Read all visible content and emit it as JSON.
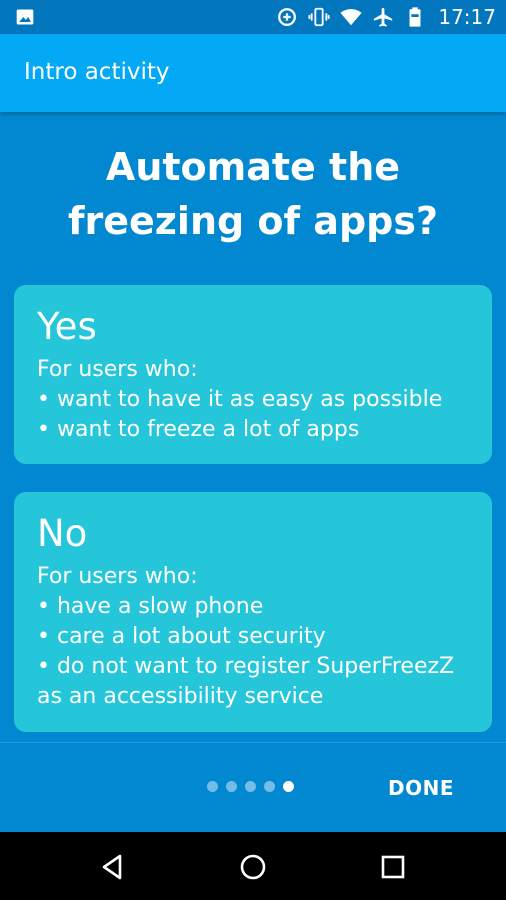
{
  "status_bar": {
    "time": "17:17",
    "icons": [
      "image-icon",
      "data-saver-icon",
      "vibrate-icon",
      "wifi-icon",
      "airplane-icon",
      "battery-icon"
    ]
  },
  "app_bar": {
    "title": "Intro activity"
  },
  "headline": "Automate the\nfreezing of apps?",
  "options": {
    "yes": {
      "title": "Yes",
      "lines": [
        "For users who:",
        "• want to have it as easy as possible",
        "• want to freeze a lot of apps"
      ]
    },
    "no": {
      "title": "No",
      "lines": [
        "For users who:",
        "• have a slow phone",
        "• care a lot about security",
        "• do not want to register SuperFreezZ",
        "as an accessibility service"
      ]
    }
  },
  "pager": {
    "total": 5,
    "current": 5
  },
  "footer": {
    "done_label": "DONE"
  },
  "colors": {
    "status_bar": "#0277bd",
    "app_bar": "#03a9f4",
    "background": "#0288d1",
    "card": "#26c6da"
  },
  "nav_bar": {
    "buttons": [
      "back-icon",
      "home-icon",
      "recents-icon"
    ]
  }
}
